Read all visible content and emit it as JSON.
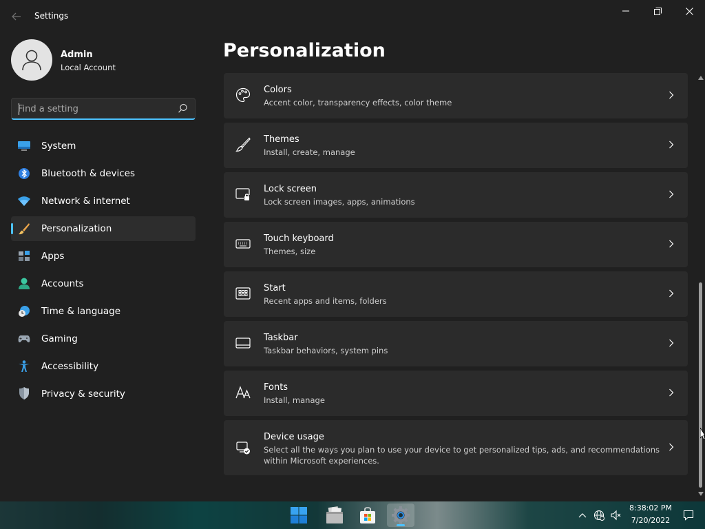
{
  "window": {
    "title": "Settings",
    "back_icon": "arrow-left-icon",
    "controls": [
      "minimize-icon",
      "maximize-icon",
      "close-icon"
    ]
  },
  "user": {
    "name": "Admin",
    "account_type": "Local Account",
    "avatar_icon": "person-icon"
  },
  "search": {
    "placeholder": "Find a setting",
    "value": "",
    "icon": "search-icon"
  },
  "sidebar": {
    "items": [
      {
        "label": "System",
        "icon": "monitor-icon",
        "active": false
      },
      {
        "label": "Bluetooth & devices",
        "icon": "bluetooth-icon",
        "active": false
      },
      {
        "label": "Network & internet",
        "icon": "wifi-icon",
        "active": false
      },
      {
        "label": "Personalization",
        "icon": "paintbrush-icon",
        "active": true
      },
      {
        "label": "Apps",
        "icon": "apps-icon",
        "active": false
      },
      {
        "label": "Accounts",
        "icon": "account-icon",
        "active": false
      },
      {
        "label": "Time & language",
        "icon": "globe-clock-icon",
        "active": false
      },
      {
        "label": "Gaming",
        "icon": "gamepad-icon",
        "active": false
      },
      {
        "label": "Accessibility",
        "icon": "accessibility-icon",
        "active": false
      },
      {
        "label": "Privacy & security",
        "icon": "shield-icon",
        "active": false
      }
    ]
  },
  "main": {
    "title": "Personalization",
    "cards": [
      {
        "title": "Colors",
        "subtitle": "Accent color, transparency effects, color theme",
        "icon": "palette-icon"
      },
      {
        "title": "Themes",
        "subtitle": "Install, create, manage",
        "icon": "brush-icon"
      },
      {
        "title": "Lock screen",
        "subtitle": "Lock screen images, apps, animations",
        "icon": "lock-screen-icon"
      },
      {
        "title": "Touch keyboard",
        "subtitle": "Themes, size",
        "icon": "keyboard-icon"
      },
      {
        "title": "Start",
        "subtitle": "Recent apps and items, folders",
        "icon": "start-menu-icon"
      },
      {
        "title": "Taskbar",
        "subtitle": "Taskbar behaviors, system pins",
        "icon": "taskbar-icon"
      },
      {
        "title": "Fonts",
        "subtitle": "Install, manage",
        "icon": "fonts-icon"
      },
      {
        "title": "Device usage",
        "subtitle": "Select all the ways you plan to use your device to get personalized tips, ads, and recommendations within Microsoft experiences.",
        "icon": "device-usage-icon"
      }
    ]
  },
  "taskbar": {
    "apps": [
      "windows-start-icon",
      "file-explorer-icon",
      "microsoft-store-icon",
      "settings-gear-icon"
    ],
    "tray": [
      "chevron-up-icon",
      "network-globe-icon",
      "volume-muted-icon",
      "notification-icon"
    ],
    "time": "8:38:02 PM",
    "date": "7/20/2022"
  },
  "colors": {
    "accent": "#4cc2ff",
    "background": "#202020",
    "card": "#2b2b2b"
  }
}
